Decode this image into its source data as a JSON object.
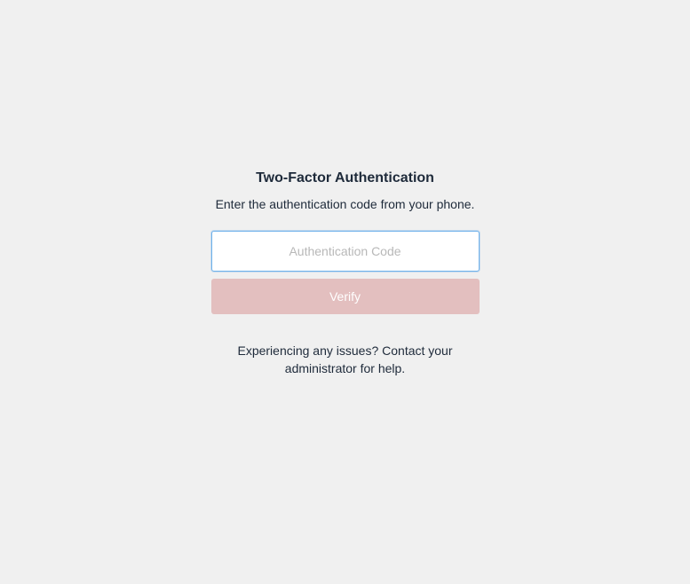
{
  "title": "Two-Factor Authentication",
  "subtitle": "Enter the authentication code from your phone.",
  "input": {
    "placeholder": "Authentication Code",
    "value": ""
  },
  "verify_label": "Verify",
  "help_text": "Experiencing any issues? Contact your administrator for help."
}
